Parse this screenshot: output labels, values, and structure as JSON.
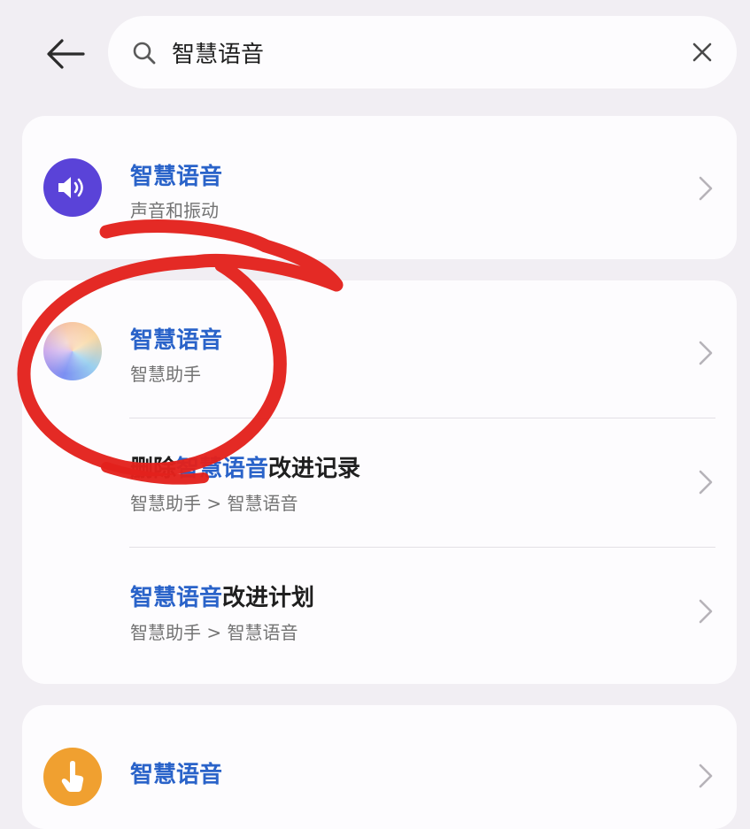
{
  "header": {
    "search": {
      "value": "智慧语音",
      "placeholder": ""
    }
  },
  "results": [
    {
      "items": [
        {
          "title_highlight": "智慧语音",
          "title_rest": "",
          "subtitle": "声音和振动",
          "icon": "speaker-icon",
          "icon_color": "#5a43d8"
        }
      ]
    },
    {
      "items": [
        {
          "title_highlight": "智慧语音",
          "title_rest": "",
          "subtitle": "智慧助手",
          "icon": "smart-assistant-icon"
        },
        {
          "title_prefix": "删除",
          "title_highlight": "智慧语音",
          "title_rest": "改进记录",
          "subtitle": "智慧助手 > 智慧语音"
        },
        {
          "title_highlight": "智慧语音",
          "title_rest": "改进计划",
          "subtitle": "智慧助手 > 智慧语音"
        }
      ]
    },
    {
      "items": [
        {
          "title_highlight": "智慧语音",
          "title_rest": "",
          "subtitle": "",
          "icon": "touch-hand-icon",
          "icon_color": "#f0a030"
        }
      ]
    }
  ],
  "colors": {
    "highlight": "#2a63c9",
    "annotation": "#e3211c",
    "background": "#f1eef3"
  }
}
